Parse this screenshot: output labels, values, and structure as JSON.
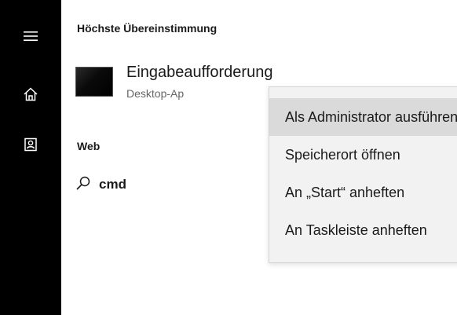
{
  "rail": {
    "items": [
      {
        "icon": "hamburger-menu-icon"
      },
      {
        "icon": "home-icon"
      },
      {
        "icon": "documents-icon"
      }
    ]
  },
  "best_match": {
    "section_title": "Höchste Übereinstimmung",
    "app": {
      "name": "Eingabeaufforderung",
      "subtitle": "Desktop-Ap",
      "icon": "command-prompt-thumbnail"
    }
  },
  "web": {
    "section_title": "Web",
    "query": "cmd",
    "icon": "search-icon"
  },
  "context_menu": {
    "items": [
      {
        "label": "Als Administrator ausführen",
        "highlighted": true
      },
      {
        "label": "Speicherort öffnen"
      },
      {
        "label": "An „Start“ anheften"
      },
      {
        "label": "An Taskleiste anheften"
      }
    ]
  },
  "colors": {
    "rail_bg": "#000000",
    "panel_bg": "#ffffff",
    "menu_bg": "#f2f2f2",
    "menu_hover": "#dadada"
  }
}
